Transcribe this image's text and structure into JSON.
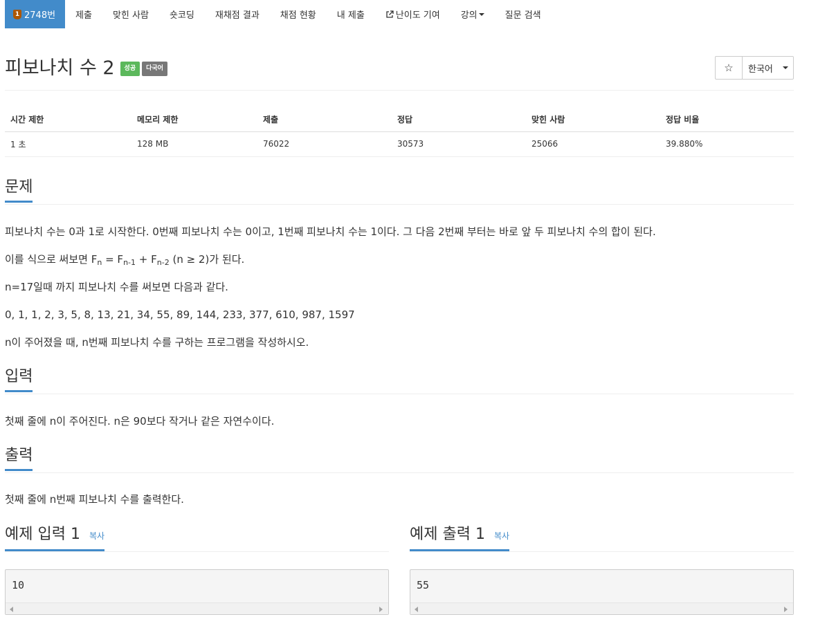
{
  "nav": {
    "tier_badge": "1",
    "tabs": [
      {
        "label": "2748번"
      },
      {
        "label": "제출"
      },
      {
        "label": "맞힌 사람"
      },
      {
        "label": "숏코딩"
      },
      {
        "label": "재채점 결과"
      },
      {
        "label": "채점 현황"
      },
      {
        "label": "내 제출"
      },
      {
        "label": "난이도 기여"
      },
      {
        "label": "강의"
      },
      {
        "label": "질문 검색"
      }
    ]
  },
  "problem": {
    "title": "피보나치 수 2",
    "labels": [
      "성공",
      "다국어"
    ],
    "star_icon": "☆",
    "language": "한국어"
  },
  "stats": {
    "headers": [
      "시간 제한",
      "메모리 제한",
      "제출",
      "정답",
      "맞힌 사람",
      "정답 비율"
    ],
    "values": [
      "1 초",
      "128 MB",
      "76022",
      "30573",
      "25066",
      "39.880%"
    ]
  },
  "sections": {
    "problem": {
      "title": "문제",
      "p1": "피보나치 수는 0과 1로 시작한다. 0번째 피보나치 수는 0이고, 1번째 피보나치 수는 1이다. 그 다음 2번째 부터는 바로 앞 두 피보나치 수의 합이 된다.",
      "p2_prefix": "이를 식으로 써보면 F",
      "p2_sub1": "n",
      "p2_eq": " = F",
      "p2_sub2": "n-1",
      "p2_plus": " + F",
      "p2_sub3": "n-2",
      "p2_suffix": " (n ≥ 2)가 된다.",
      "p3": "n=17일때 까지 피보나치 수를 써보면 다음과 같다.",
      "p4": "0, 1, 1, 2, 3, 5, 8, 13, 21, 34, 55, 89, 144, 233, 377, 610, 987, 1597",
      "p5": "n이 주어졌을 때, n번째 피보나치 수를 구하는 프로그램을 작성하시오."
    },
    "input": {
      "title": "입력",
      "text": "첫째 줄에 n이 주어진다. n은 90보다 작거나 같은 자연수이다."
    },
    "output": {
      "title": "출력",
      "text": "첫째 줄에 n번째 피보나치 수를 출력한다."
    },
    "sample_input": {
      "title": "예제 입력 1",
      "copy": "복사",
      "value": "10"
    },
    "sample_output": {
      "title": "예제 출력 1",
      "copy": "복사",
      "value": "55"
    }
  }
}
